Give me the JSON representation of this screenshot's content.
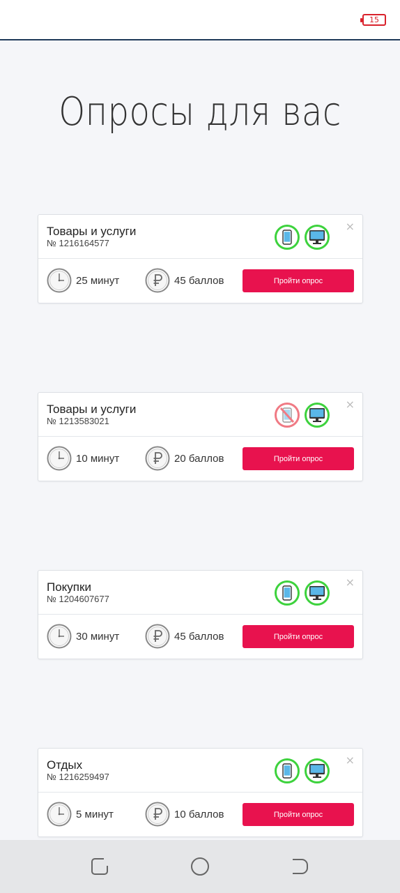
{
  "status": {
    "battery": "15"
  },
  "page": {
    "title": "Опросы для вас"
  },
  "cards": [
    {
      "title": "Товары и услуги",
      "number": "№ 1216164577",
      "time": "25 минут",
      "points": "45 баллов",
      "button": "Пройти опрос",
      "mobile_available": true,
      "desktop_available": true
    },
    {
      "title": "Товары и услуги",
      "number": "№ 1213583021",
      "time": "10 минут",
      "points": "20 баллов",
      "button": "Пройти опрос",
      "mobile_available": false,
      "desktop_available": true
    },
    {
      "title": "Покупки",
      "number": "№ 1204607677",
      "time": "30 минут",
      "points": "45 баллов",
      "button": "Пройти опрос",
      "mobile_available": true,
      "desktop_available": true
    },
    {
      "title": "Отдых",
      "number": "№ 1216259497",
      "time": "5 минут",
      "points": "10 баллов",
      "button": "Пройти опрос",
      "mobile_available": true,
      "desktop_available": true
    }
  ],
  "icons": {
    "close": "×",
    "clock": "clock-icon",
    "coin": "ruble-coin-icon",
    "mobile": "smartphone-icon",
    "desktop": "monitor-icon"
  },
  "colors": {
    "accent": "#e8124e",
    "device_ok": "#3dd23d",
    "device_disabled": "#f07a84",
    "battery": "#d9212b"
  }
}
